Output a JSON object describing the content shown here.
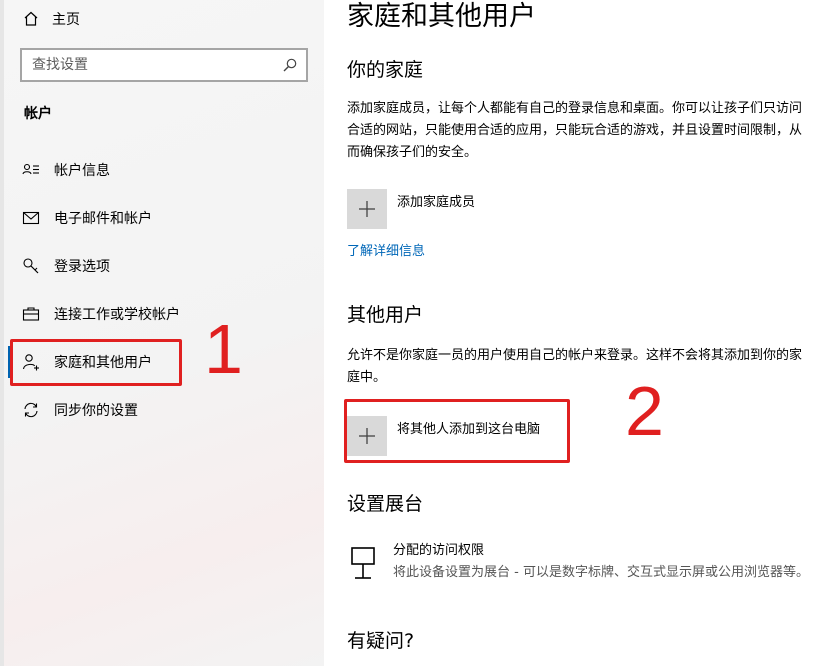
{
  "sidebar": {
    "home_label": "主页",
    "search_placeholder": "查找设置",
    "section_label": "帐户",
    "items": [
      {
        "label": "帐户信息"
      },
      {
        "label": "电子邮件和帐户"
      },
      {
        "label": "登录选项"
      },
      {
        "label": "连接工作或学校帐户"
      },
      {
        "label": "家庭和其他用户"
      },
      {
        "label": "同步你的设置"
      }
    ]
  },
  "annotations": {
    "one": "1",
    "two": "2",
    "color": "#e02020"
  },
  "main": {
    "title": "家庭和其他用户",
    "family": {
      "heading": "你的家庭",
      "description": "添加家庭成员，让每个人都能有自己的登录信息和桌面。你可以让孩子们只访问合适的网站，只能使用合适的应用，只能玩合适的游戏，并且设置时间限制，从而确保孩子们的安全。",
      "add_label": "添加家庭成员",
      "learn_more": "了解详细信息"
    },
    "other_users": {
      "heading": "其他用户",
      "description": "允许不是你家庭一员的用户使用自己的帐户来登录。这样不会将其添加到你的家庭中。",
      "add_label": "将其他人添加到这台电脑"
    },
    "kiosk": {
      "heading": "设置展台",
      "title": "分配的访问权限",
      "description": "将此设备设置为展台 - 可以是数字标牌、交互式显示屏或公用浏览器等。"
    },
    "questions": {
      "heading": "有疑问?"
    }
  },
  "colors": {
    "accent": "#0063b1",
    "link": "#0067b8",
    "tile": "#d9d9d9"
  }
}
